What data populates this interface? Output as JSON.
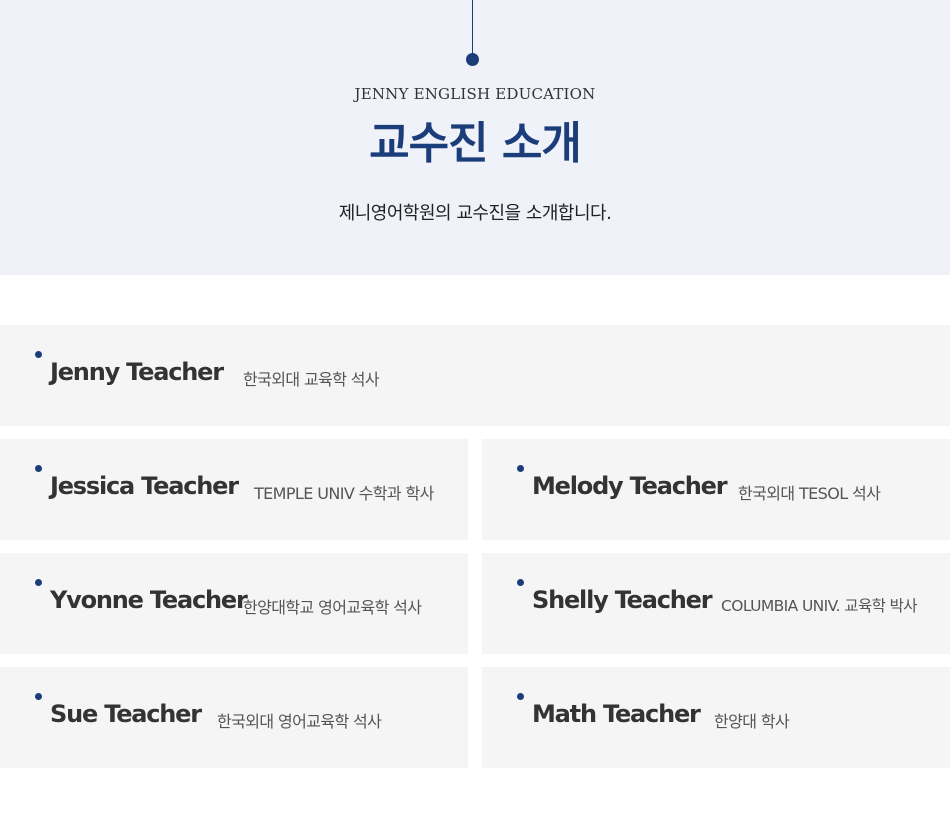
{
  "header": {
    "eyebrow": "JENNY ENGLISH EDUCATION",
    "title": "교수진 소개",
    "subtitle": "제니영어학원의 교수진을 소개합니다."
  },
  "teachers": [
    {
      "name": "Jenny Teacher",
      "degree": "한국외대 교육학 석사"
    },
    {
      "name": "Jessica Teacher",
      "degree": "TEMPLE UNIV 수학과 학사"
    },
    {
      "name": "Melody Teacher",
      "degree": "한국외대 TESOL 석사"
    },
    {
      "name": "Yvonne Teacher",
      "degree": "한양대학교 영어교육학 석사"
    },
    {
      "name": "Shelly Teacher",
      "degree": "COLUMBIA UNIV. 교육학 박사"
    },
    {
      "name": "Sue Teacher",
      "degree": "한국외대 영어교육학 석사"
    },
    {
      "name": "Math Teacher",
      "degree": "한양대 학사"
    }
  ],
  "colors": {
    "accent": "#1b3d7a",
    "hero_background": "#eff3f9",
    "card_background": "#f5f5f5"
  }
}
